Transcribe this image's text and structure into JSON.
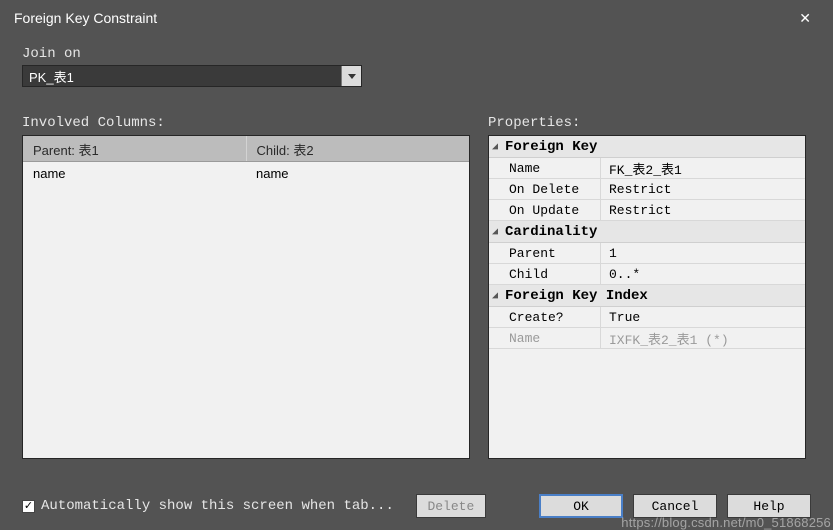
{
  "window": {
    "title": "Foreign Key Constraint"
  },
  "join": {
    "label": "Join on",
    "value": "PK_表1"
  },
  "involved": {
    "title": "Involved Columns:",
    "headers": {
      "parent": "Parent: 表1",
      "child": "Child: 表2"
    },
    "rows": [
      {
        "parent": "name",
        "child": "name"
      }
    ]
  },
  "properties": {
    "title": "Properties:",
    "groups": {
      "fk": {
        "label": "Foreign Key",
        "name_key": "Name",
        "name_val": "FK_表2_表1",
        "ondelete_key": "On Delete",
        "ondelete_val": "Restrict",
        "onupdate_key": "On Update",
        "onupdate_val": "Restrict"
      },
      "card": {
        "label": "Cardinality",
        "parent_key": "Parent",
        "parent_val": "1",
        "child_key": "Child",
        "child_val": "0..*"
      },
      "idx": {
        "label": "Foreign Key Index",
        "create_key": "Create?",
        "create_val": "True",
        "name_key": "Name",
        "name_val": "IXFK_表2_表1 (*)"
      }
    }
  },
  "footer": {
    "checkbox_label": "Automatically show this screen when tab...",
    "delete": "Delete",
    "ok": "OK",
    "cancel": "Cancel",
    "help": "Help"
  },
  "watermark": "https://blog.csdn.net/m0_51868256"
}
